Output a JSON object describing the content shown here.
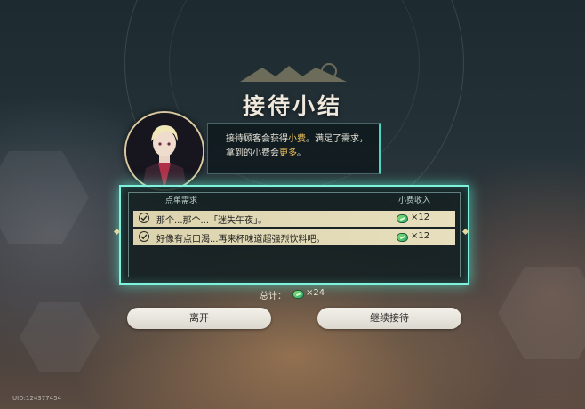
{
  "summary": {
    "title": "接待小结",
    "message": {
      "part1": "接待顾客会获得",
      "highlight1": "小费",
      "part2": "。满足了需求，拿到的小费会",
      "highlight2": "更多",
      "part3": "。"
    }
  },
  "orders": {
    "col_request": "点单需求",
    "col_tip": "小费收入",
    "rows": [
      {
        "text": "那个...那个...「迷失午夜」。",
        "tip": "×12",
        "fulfilled": true
      },
      {
        "text": "好像有点口渴...再来杯味道超强烈饮料吧。",
        "tip": "×12",
        "fulfilled": true
      }
    ]
  },
  "total": {
    "label": "总计：",
    "count": "×24"
  },
  "buttons": {
    "leave": "离开",
    "continue": "继续接待"
  },
  "uid": "UID:124377454",
  "icons": [
    "check-icon",
    "tip-coin-icon"
  ],
  "colors": {
    "accent": "#7ef2dc",
    "highlight": "#f2c45a"
  }
}
